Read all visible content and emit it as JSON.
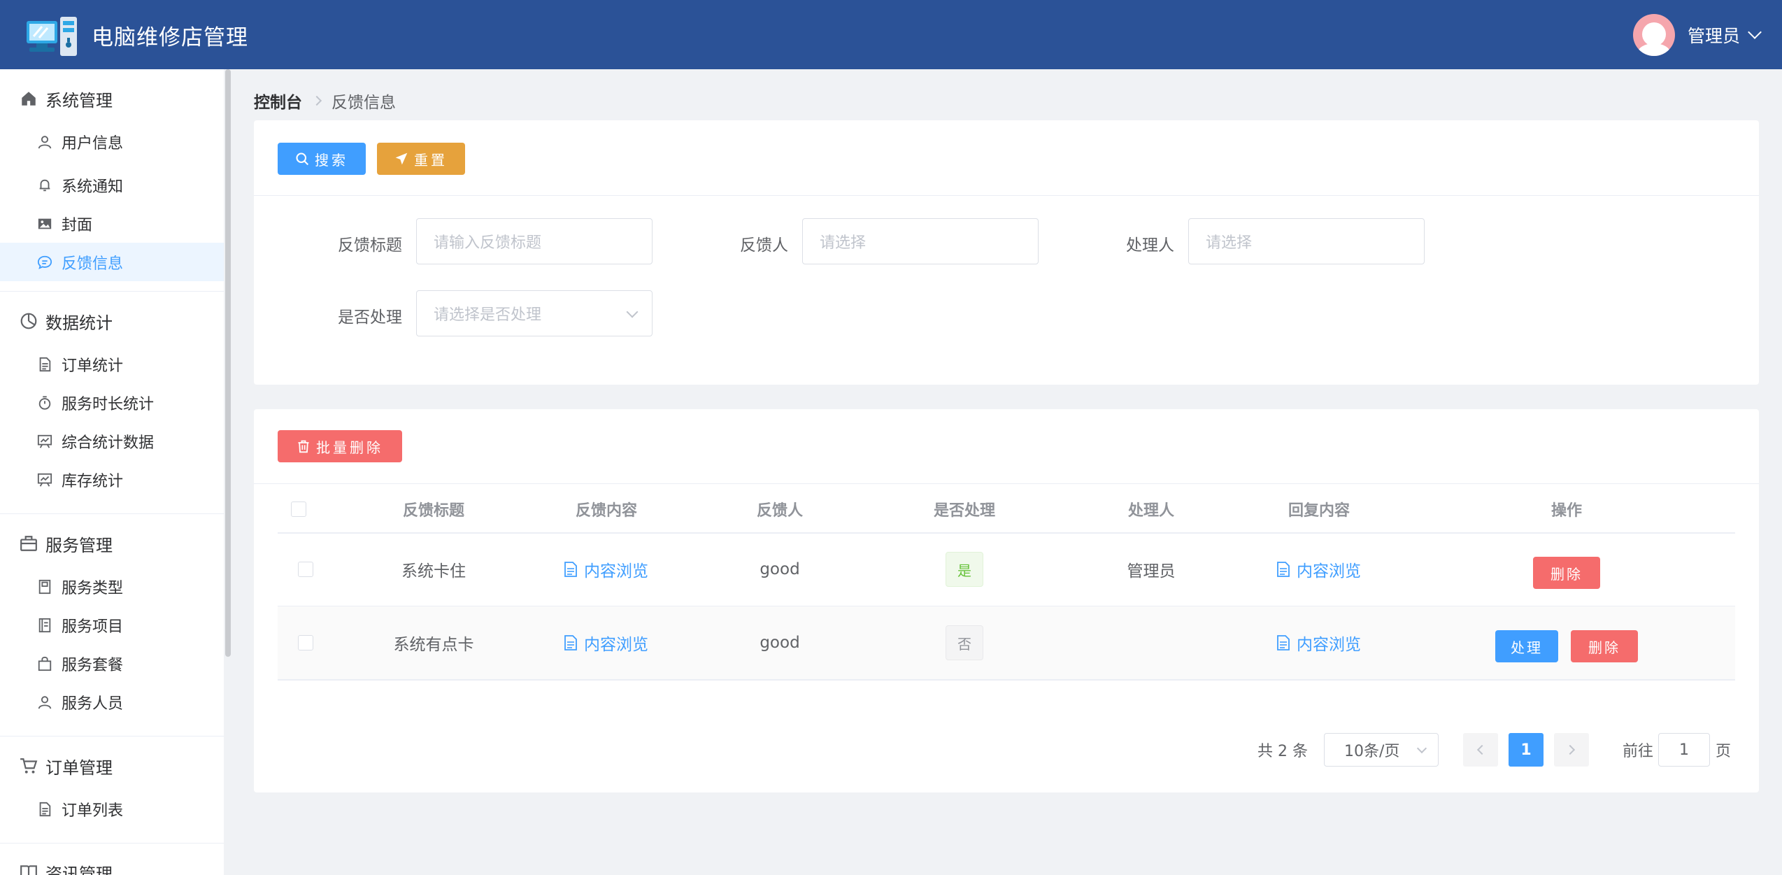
{
  "header": {
    "title": "电脑维修店管理",
    "user_name": "管理员"
  },
  "sidebar": {
    "groups": [
      {
        "title": "系统管理",
        "icon": "home-icon",
        "items": [
          {
            "label": "用户信息",
            "icon": "user-icon"
          },
          {
            "label": "系统通知",
            "icon": "bell-icon"
          },
          {
            "label": "封面",
            "icon": "picture-icon"
          },
          {
            "label": "反馈信息",
            "icon": "chat-icon",
            "active": true
          }
        ]
      },
      {
        "title": "数据统计",
        "icon": "pie-chart-icon",
        "items": [
          {
            "label": "订单统计",
            "icon": "document-icon"
          },
          {
            "label": "服务时长统计",
            "icon": "stopwatch-icon"
          },
          {
            "label": "综合统计数据",
            "icon": "data-board-icon"
          },
          {
            "label": "库存统计",
            "icon": "data-board-icon"
          }
        ]
      },
      {
        "title": "服务管理",
        "icon": "briefcase-icon",
        "items": [
          {
            "label": "服务类型",
            "icon": "notebook-icon"
          },
          {
            "label": "服务项目",
            "icon": "tickets-icon"
          },
          {
            "label": "服务套餐",
            "icon": "bag-icon"
          },
          {
            "label": "服务人员",
            "icon": "user-icon"
          }
        ]
      },
      {
        "title": "订单管理",
        "icon": "cart-icon",
        "items": [
          {
            "label": "订单列表",
            "icon": "document-icon"
          }
        ]
      },
      {
        "title": "资讯管理",
        "icon": "reading-icon",
        "items": []
      }
    ]
  },
  "breadcrumb": {
    "home": "控制台",
    "current": "反馈信息"
  },
  "search": {
    "search_btn": "搜索",
    "reset_btn": "重置",
    "fields": {
      "title_label": "反馈标题",
      "title_placeholder": "请输入反馈标题",
      "feedbacker_label": "反馈人",
      "feedbacker_placeholder": "请选择",
      "handler_label": "处理人",
      "handler_placeholder": "请选择",
      "processed_label": "是否处理",
      "processed_placeholder": "请选择是否处理"
    }
  },
  "table": {
    "batch_delete": "批量删除",
    "columns": [
      "反馈标题",
      "反馈内容",
      "反馈人",
      "是否处理",
      "处理人",
      "回复内容",
      "操作"
    ],
    "rows": [
      {
        "title": "系统卡住",
        "content": "内容浏览",
        "feedbacker": "good",
        "processed": "是",
        "handler": "管理员",
        "reply": "内容浏览",
        "actions": [
          "删除"
        ]
      },
      {
        "title": "系统有点卡",
        "content": "内容浏览",
        "feedbacker": "good",
        "processed": "否",
        "handler": "",
        "reply": "内容浏览",
        "actions": [
          "处理",
          "删除"
        ]
      }
    ]
  },
  "pagination": {
    "total": "共 2 条",
    "page_size": "10条/页",
    "current_page": "1",
    "jump_prefix": "前往",
    "jump_value": "1",
    "jump_suffix": "页"
  },
  "colors": {
    "header": "#2b5297",
    "primary": "#409eff",
    "warning": "#e6a23c",
    "danger": "#f56c6c",
    "success": "#67c23a"
  }
}
